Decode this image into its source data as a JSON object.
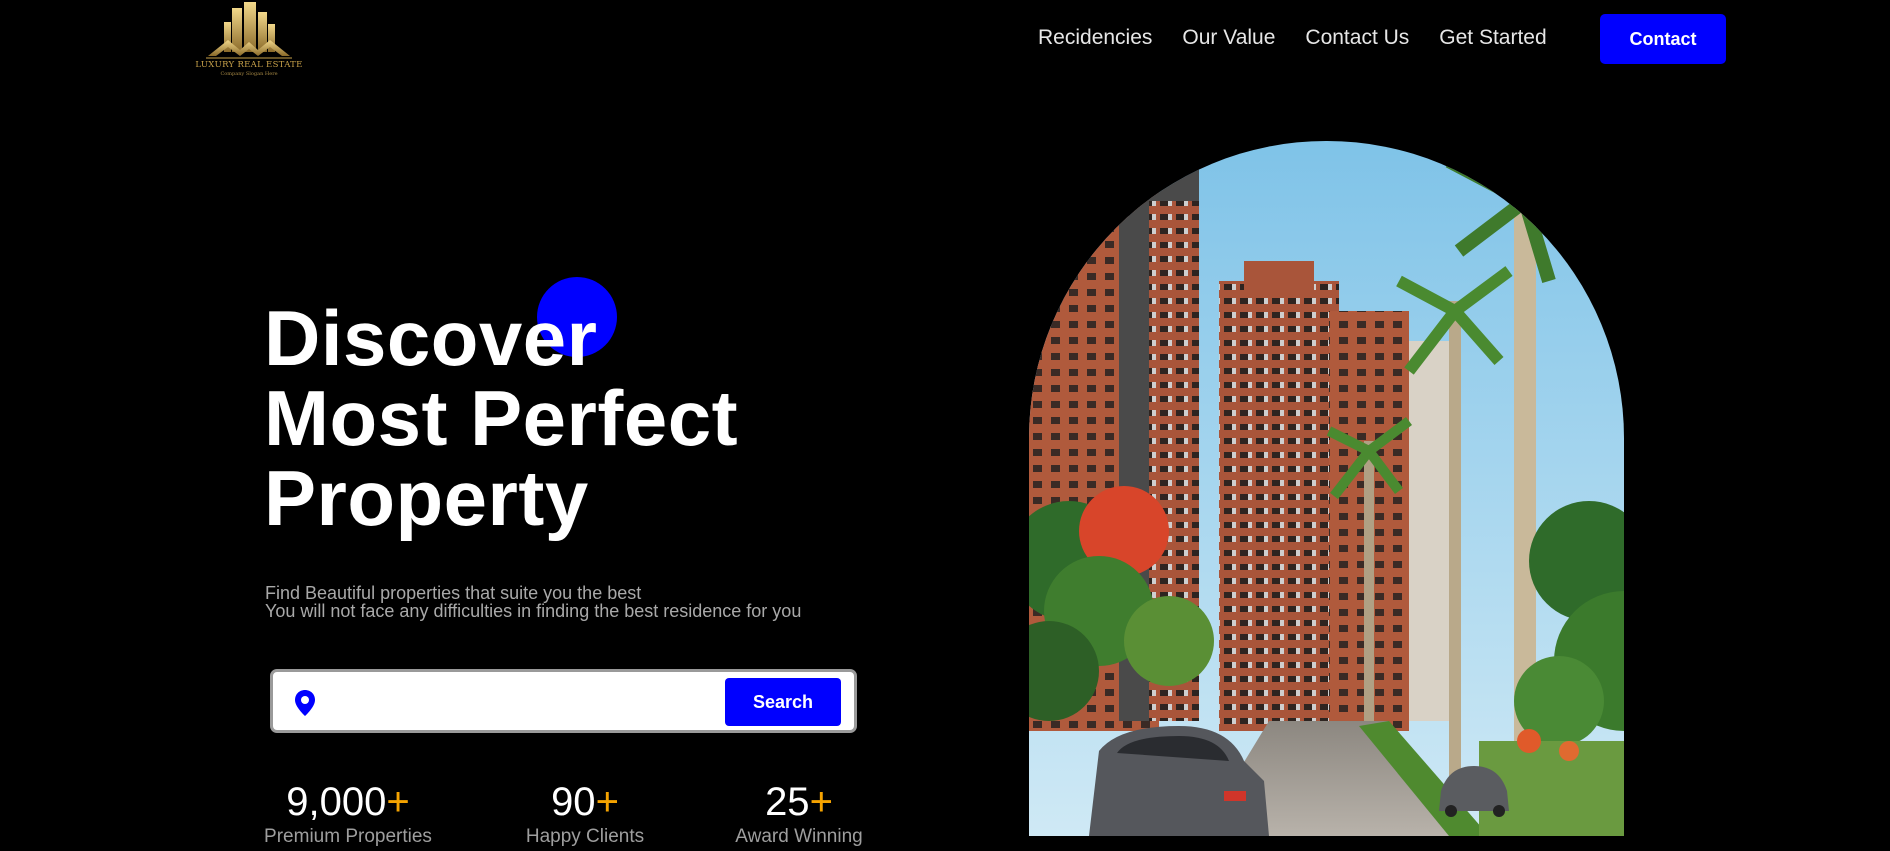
{
  "header": {
    "logo": {
      "name": "LUXURY REAL ESTATE",
      "tagline": "Company Slogan Here",
      "icon": "building-logo-icon"
    },
    "nav": [
      "Recidencies",
      "Our Value",
      "Contact Us",
      "Get Started"
    ],
    "contact_button": "Contact"
  },
  "hero": {
    "title_lines": [
      "Discover",
      "Most Perfect",
      "Property"
    ],
    "subtitle_lines": [
      "Find Beautiful properties that suite you the best",
      "You will not face any difficulties in finding the best residence for you"
    ],
    "search": {
      "icon": "location-pin-icon",
      "value": "",
      "placeholder": "",
      "button": "Search"
    },
    "stats": [
      {
        "value": "9,000",
        "suffix": "+",
        "label": "Premium Properties"
      },
      {
        "value": "90",
        "suffix": "+",
        "label": "Happy Clients"
      },
      {
        "value": "25",
        "suffix": "+",
        "label": "Award Winning"
      }
    ],
    "image": "residential-towers-with-palm-trees"
  },
  "colors": {
    "background": "#000000",
    "accent": "#0000ff",
    "stat_plus": "#f5a300",
    "logo_gold": "#c9a24a"
  }
}
